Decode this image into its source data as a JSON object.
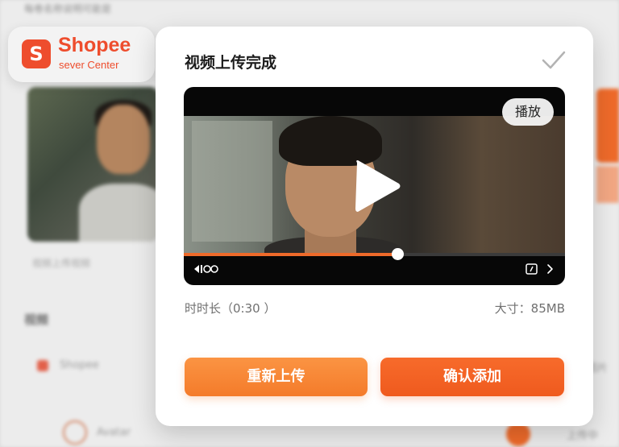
{
  "background": {
    "top_text": "每卷名称说明可能是",
    "caption": "视频上传视频",
    "heading": "视频",
    "row1_label": "Shopee",
    "row2_label": "Avatar",
    "right_text": "图片",
    "right_text2": "上传中"
  },
  "logo": {
    "glyph": "S",
    "name": "Shopee",
    "subtitle": "sever Center",
    "brand_color": "#ee4d2d"
  },
  "modal": {
    "title": "视频上传完成",
    "confirm_icon": "checkmark-icon",
    "video": {
      "play_pill_label": "播放",
      "progress_fraction": 0.56,
      "accent_color": "#ee6a2a",
      "icons": [
        "play-icon",
        "volume-icon",
        "screen-icon",
        "next-icon"
      ]
    },
    "duration_label": "时时长（0:30 ）",
    "size_label": "大寸：85MB",
    "buttons": {
      "reupload": "重新上传",
      "confirm": "确认添加"
    }
  }
}
